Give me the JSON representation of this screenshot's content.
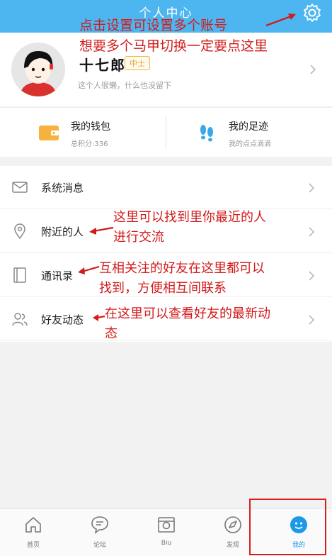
{
  "header": {
    "title": "个人中心",
    "settings_icon": "gear-icon"
  },
  "profile": {
    "name": "十七郎",
    "level": "中士",
    "signature": "这个人很懒，什么也没留下"
  },
  "stats": {
    "wallet": {
      "title": "我的钱包",
      "subtitle": "总积分:336"
    },
    "footprint": {
      "title": "我的足迹",
      "subtitle": "我的点点滴滴"
    }
  },
  "menu": [
    {
      "label": "系统消息",
      "icon": "mail-icon"
    },
    {
      "label": "附近的人",
      "icon": "location-pin-icon"
    },
    {
      "label": "通讯录",
      "icon": "contacts-book-icon"
    },
    {
      "label": "好友动态",
      "icon": "friends-icon"
    }
  ],
  "tabs": [
    {
      "label": "首页",
      "icon": "home-icon"
    },
    {
      "label": "论坛",
      "icon": "chat-bubble-icon"
    },
    {
      "label": "Biu",
      "icon": "camera-icon"
    },
    {
      "label": "发现",
      "icon": "compass-icon"
    },
    {
      "label": "我的",
      "icon": "user-icon",
      "active": true
    }
  ],
  "annotations": {
    "settings_line1": "点击设置可设置多个账号",
    "settings_line2": "想要多个马甲切换一定要点这里",
    "nearby_line1": "这里可以找到里你最近的人",
    "nearby_line2": "进行交流",
    "contacts_line1": "互相关注的好友在这里都可以",
    "contacts_line2": "找到，方便相互间联系",
    "friends_line1": "在这里可以查看好友的最新动",
    "friends_line2": "态"
  },
  "colors": {
    "header": "#4db6f0",
    "annotation": "#d21b1b",
    "accent": "#1a9ae8"
  }
}
